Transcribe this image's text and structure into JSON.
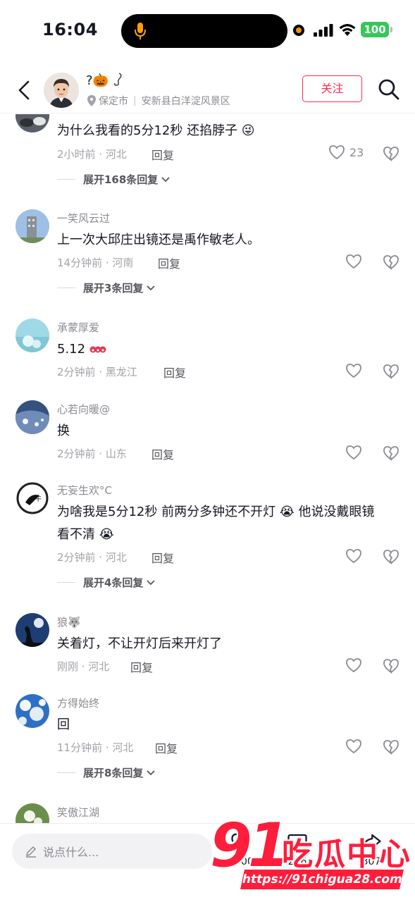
{
  "status_bar": {
    "time": "16:04",
    "battery": "100",
    "icons": [
      "mic-icon",
      "orange-dot-indicator",
      "cellular-signal-icon",
      "wifi-icon",
      "battery-icon"
    ]
  },
  "header": {
    "back_icon": "chevron-left-icon",
    "user_name": "?🎃",
    "location_city": "保定市",
    "location_detail": "安新县白洋淀风景区",
    "follow_label": "关注",
    "search_icon": "search-icon"
  },
  "comments": [
    {
      "user": "",
      "text": "为什么我看的5分12秒 还掐脖子 😜",
      "meta": "2小时前 · 河北",
      "reply_label": "回复",
      "likes": "23",
      "expand_label": "展开168条回复"
    },
    {
      "user": "一笑风云过",
      "text": "上一次大邱庄出镜还是禹作敏老人。",
      "meta": "14分钟前 · 河南",
      "reply_label": "回复",
      "likes": "",
      "expand_label": "展开3条回复"
    },
    {
      "user": "承蒙厚爱",
      "text": "5.12",
      "meta": "2分钟前 · 黑龙江",
      "reply_label": "回复",
      "likes": ""
    },
    {
      "user": "心若向暖@",
      "text": "换",
      "meta": "2分钟前 · 山东",
      "reply_label": "回复",
      "likes": ""
    },
    {
      "user": "无妄生欢°C",
      "text": "为啥我是5分12秒 前两分多钟还不开灯 😭 他说没戴眼镜",
      "text2": "看不清 😭",
      "meta": "2分钟前 · 河北",
      "reply_label": "回复",
      "likes": "",
      "expand_label": "展开4条回复"
    },
    {
      "user": "狼🐺",
      "text": "关着灯，不让开灯后来开灯了",
      "meta": "刚刚 · 河北",
      "reply_label": "回复",
      "likes": ""
    },
    {
      "user": "方得始终",
      "text": "回",
      "meta": "11分钟前 · 河北",
      "reply_label": "回复",
      "likes": "",
      "expand_label": "展开8条回复"
    },
    {
      "user": "笑傲江湖",
      "text": "",
      "meta": "",
      "reply_label": "",
      "likes": ""
    }
  ],
  "bottom_bar": {
    "input_placeholder": "说点什么...",
    "actions": [
      {
        "icon": "heart-icon",
        "count": "3500"
      },
      {
        "icon": "comment-icon",
        "count": "236"
      },
      {
        "icon": "share-icon",
        "count": "307"
      }
    ]
  },
  "watermark": {
    "logo_number": "91",
    "logo_text": "吃瓜中心",
    "url": "https://91chigua28.com"
  },
  "colors": {
    "accent": "#fe2c55",
    "battery": "#34c759",
    "text_primary": "#161823",
    "text_secondary": "#8a8b91"
  }
}
